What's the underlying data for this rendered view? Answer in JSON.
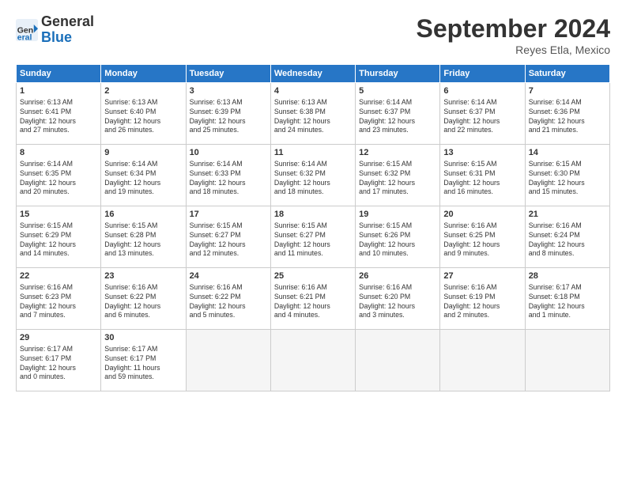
{
  "logo": {
    "line1": "General",
    "line2": "Blue"
  },
  "title": "September 2024",
  "subtitle": "Reyes Etla, Mexico",
  "days_of_week": [
    "Sunday",
    "Monday",
    "Tuesday",
    "Wednesday",
    "Thursday",
    "Friday",
    "Saturday"
  ],
  "weeks": [
    [
      {
        "num": "1",
        "info": "Sunrise: 6:13 AM\nSunset: 6:41 PM\nDaylight: 12 hours\nand 27 minutes."
      },
      {
        "num": "2",
        "info": "Sunrise: 6:13 AM\nSunset: 6:40 PM\nDaylight: 12 hours\nand 26 minutes."
      },
      {
        "num": "3",
        "info": "Sunrise: 6:13 AM\nSunset: 6:39 PM\nDaylight: 12 hours\nand 25 minutes."
      },
      {
        "num": "4",
        "info": "Sunrise: 6:13 AM\nSunset: 6:38 PM\nDaylight: 12 hours\nand 24 minutes."
      },
      {
        "num": "5",
        "info": "Sunrise: 6:14 AM\nSunset: 6:37 PM\nDaylight: 12 hours\nand 23 minutes."
      },
      {
        "num": "6",
        "info": "Sunrise: 6:14 AM\nSunset: 6:37 PM\nDaylight: 12 hours\nand 22 minutes."
      },
      {
        "num": "7",
        "info": "Sunrise: 6:14 AM\nSunset: 6:36 PM\nDaylight: 12 hours\nand 21 minutes."
      }
    ],
    [
      {
        "num": "8",
        "info": "Sunrise: 6:14 AM\nSunset: 6:35 PM\nDaylight: 12 hours\nand 20 minutes."
      },
      {
        "num": "9",
        "info": "Sunrise: 6:14 AM\nSunset: 6:34 PM\nDaylight: 12 hours\nand 19 minutes."
      },
      {
        "num": "10",
        "info": "Sunrise: 6:14 AM\nSunset: 6:33 PM\nDaylight: 12 hours\nand 18 minutes."
      },
      {
        "num": "11",
        "info": "Sunrise: 6:14 AM\nSunset: 6:32 PM\nDaylight: 12 hours\nand 18 minutes."
      },
      {
        "num": "12",
        "info": "Sunrise: 6:15 AM\nSunset: 6:32 PM\nDaylight: 12 hours\nand 17 minutes."
      },
      {
        "num": "13",
        "info": "Sunrise: 6:15 AM\nSunset: 6:31 PM\nDaylight: 12 hours\nand 16 minutes."
      },
      {
        "num": "14",
        "info": "Sunrise: 6:15 AM\nSunset: 6:30 PM\nDaylight: 12 hours\nand 15 minutes."
      }
    ],
    [
      {
        "num": "15",
        "info": "Sunrise: 6:15 AM\nSunset: 6:29 PM\nDaylight: 12 hours\nand 14 minutes."
      },
      {
        "num": "16",
        "info": "Sunrise: 6:15 AM\nSunset: 6:28 PM\nDaylight: 12 hours\nand 13 minutes."
      },
      {
        "num": "17",
        "info": "Sunrise: 6:15 AM\nSunset: 6:27 PM\nDaylight: 12 hours\nand 12 minutes."
      },
      {
        "num": "18",
        "info": "Sunrise: 6:15 AM\nSunset: 6:27 PM\nDaylight: 12 hours\nand 11 minutes."
      },
      {
        "num": "19",
        "info": "Sunrise: 6:15 AM\nSunset: 6:26 PM\nDaylight: 12 hours\nand 10 minutes."
      },
      {
        "num": "20",
        "info": "Sunrise: 6:16 AM\nSunset: 6:25 PM\nDaylight: 12 hours\nand 9 minutes."
      },
      {
        "num": "21",
        "info": "Sunrise: 6:16 AM\nSunset: 6:24 PM\nDaylight: 12 hours\nand 8 minutes."
      }
    ],
    [
      {
        "num": "22",
        "info": "Sunrise: 6:16 AM\nSunset: 6:23 PM\nDaylight: 12 hours\nand 7 minutes."
      },
      {
        "num": "23",
        "info": "Sunrise: 6:16 AM\nSunset: 6:22 PM\nDaylight: 12 hours\nand 6 minutes."
      },
      {
        "num": "24",
        "info": "Sunrise: 6:16 AM\nSunset: 6:22 PM\nDaylight: 12 hours\nand 5 minutes."
      },
      {
        "num": "25",
        "info": "Sunrise: 6:16 AM\nSunset: 6:21 PM\nDaylight: 12 hours\nand 4 minutes."
      },
      {
        "num": "26",
        "info": "Sunrise: 6:16 AM\nSunset: 6:20 PM\nDaylight: 12 hours\nand 3 minutes."
      },
      {
        "num": "27",
        "info": "Sunrise: 6:16 AM\nSunset: 6:19 PM\nDaylight: 12 hours\nand 2 minutes."
      },
      {
        "num": "28",
        "info": "Sunrise: 6:17 AM\nSunset: 6:18 PM\nDaylight: 12 hours\nand 1 minute."
      }
    ],
    [
      {
        "num": "29",
        "info": "Sunrise: 6:17 AM\nSunset: 6:17 PM\nDaylight: 12 hours\nand 0 minutes."
      },
      {
        "num": "30",
        "info": "Sunrise: 6:17 AM\nSunset: 6:17 PM\nDaylight: 11 hours\nand 59 minutes."
      },
      {
        "num": "",
        "info": "",
        "empty": true
      },
      {
        "num": "",
        "info": "",
        "empty": true
      },
      {
        "num": "",
        "info": "",
        "empty": true
      },
      {
        "num": "",
        "info": "",
        "empty": true
      },
      {
        "num": "",
        "info": "",
        "empty": true
      }
    ]
  ]
}
